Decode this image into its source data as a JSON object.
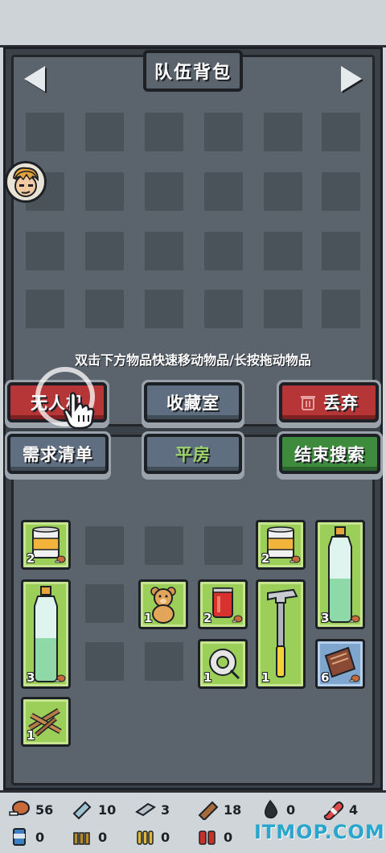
{
  "header": {
    "title": "队伍背包"
  },
  "hint": "双击下方物品快速移动物品/长按拖动物品",
  "buttons": {
    "drone": "无人机",
    "storage": "收藏室",
    "discard": "丢弃",
    "needs": "需求清单",
    "location": "平房",
    "end_search": "结束搜索"
  },
  "items": [
    {
      "name": "canned-food",
      "qty": "2"
    },
    {
      "name": "canned-food",
      "qty": "2"
    },
    {
      "name": "water-bottle",
      "qty": "3"
    },
    {
      "name": "water-bottle",
      "qty": "3"
    },
    {
      "name": "teddy-bear",
      "qty": "1"
    },
    {
      "name": "soda-can",
      "qty": "2"
    },
    {
      "name": "hammer",
      "qty": "1"
    },
    {
      "name": "tape-roll",
      "qty": "1"
    },
    {
      "name": "brown-packet",
      "qty": "6"
    },
    {
      "name": "wood-sticks",
      "qty": "1"
    }
  ],
  "resources": [
    {
      "icon": "meat-icon",
      "value": "56"
    },
    {
      "icon": "cloth-icon",
      "value": "10"
    },
    {
      "icon": "metal-icon",
      "value": "3"
    },
    {
      "icon": "wood-plank-icon",
      "value": "18"
    },
    {
      "icon": "oil-drop-icon",
      "value": "0"
    },
    {
      "icon": "pill-icon",
      "value": "4"
    },
    {
      "icon": "can-icon",
      "value": "0"
    },
    {
      "icon": "bullets-icon",
      "value": "0"
    },
    {
      "icon": "ammo-icon",
      "value": "0"
    },
    {
      "icon": "battery-icon",
      "value": "0"
    }
  ],
  "watermark": "ITMOP.COM",
  "colors": {
    "red": "#b63537",
    "green": "#3e8b3d",
    "blue": "#5f6e80",
    "item_green": "#9ccf5a",
    "item_blue": "#7fa6cf"
  }
}
